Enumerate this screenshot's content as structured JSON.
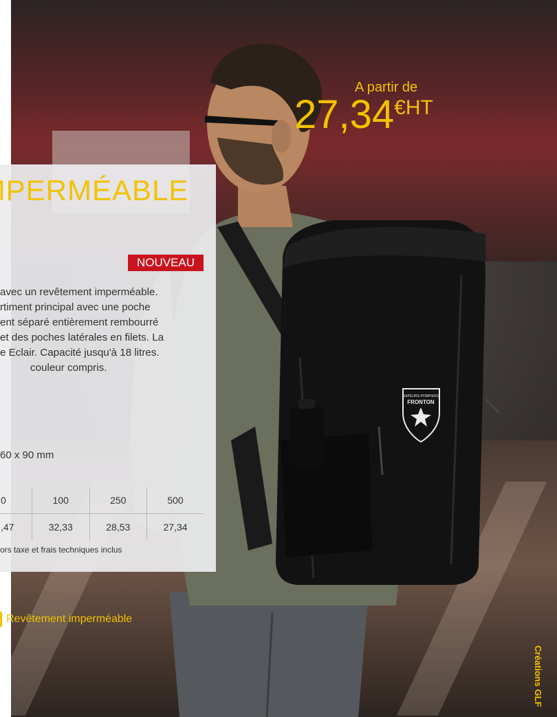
{
  "price": {
    "from": "A partir de",
    "amount": "27,34",
    "unit": "€HT"
  },
  "headline": "IMPERMÉABLE",
  "badge": "NOUVEAU",
  "description": {
    "lines": [
      "avec un revêtement imperméable.",
      "rtiment principal avec une poche",
      "ent séparé entièrement rembourré",
      "et des poches latérales en filets. La",
      "e Eclair. Capacité jusqu'à 18 litres.",
      "couleur compris."
    ]
  },
  "dimension": "60 x 90 mm",
  "price_table": {
    "quantities": [
      "0",
      "100",
      "250",
      "500"
    ],
    "prices": [
      ",47",
      "32,33",
      "28,53",
      "27,34"
    ]
  },
  "note": "ors taxe et frais techniques inclus",
  "feature": "Revêtement imperméable",
  "credit": "Créations GLF",
  "logo": {
    "line1": "SAPEURS-POMPIERS",
    "line2": "FRONTON"
  },
  "colors": {
    "accent": "#f2c200",
    "badge_bg": "#c8141f",
    "panel_bg": "#ececee"
  }
}
